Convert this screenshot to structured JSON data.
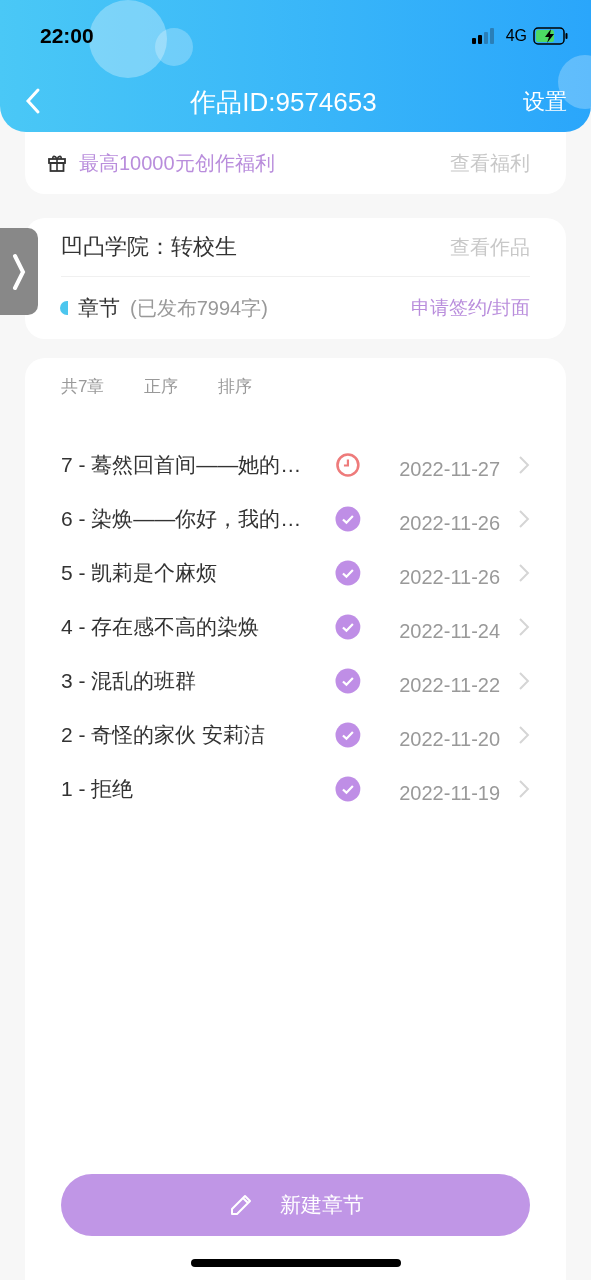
{
  "status_bar": {
    "time": "22:00",
    "network": "4G"
  },
  "nav": {
    "title": "作品ID:9574653",
    "action": "设置"
  },
  "benefit": {
    "text": "最高10000元创作福利",
    "link": "查看福利"
  },
  "work": {
    "title": "凹凸学院：转校生",
    "link": "查看作品",
    "section": "章节",
    "count": "(已发布7994字)",
    "apply": "申请签约/封面"
  },
  "list_header": {
    "total": "共7章",
    "order": "正序",
    "sort": "排序"
  },
  "chapters": [
    {
      "title": "7 - 蓦然回首间——她的…",
      "kind": "scheduled",
      "date": "2022-11-27"
    },
    {
      "title": "6 - 染焕——你好，我的…",
      "kind": "published",
      "date": "2022-11-26"
    },
    {
      "title": "5 - 凯莉是个麻烦",
      "kind": "published",
      "date": "2022-11-26"
    },
    {
      "title": "4 - 存在感不高的染焕",
      "kind": "published",
      "date": "2022-11-24"
    },
    {
      "title": "3 - 混乱的班群",
      "kind": "published",
      "date": "2022-11-22"
    },
    {
      "title": "2 - 奇怪的家伙  安莉洁",
      "kind": "published",
      "date": "2022-11-20"
    },
    {
      "title": "1 - 拒绝",
      "kind": "published",
      "date": "2022-11-19"
    }
  ],
  "new_button": "新建章节"
}
